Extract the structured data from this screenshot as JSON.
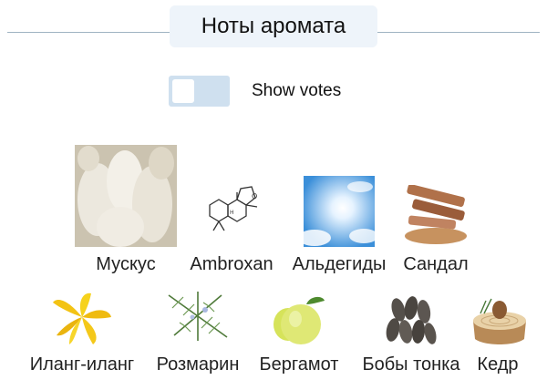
{
  "header": {
    "title": "Ноты аромата"
  },
  "votes_toggle": {
    "label": "Show votes",
    "checked": false
  },
  "notes_row1": [
    {
      "label": "Мускус",
      "icon": "musk-image"
    },
    {
      "label": "Ambroxan",
      "icon": "ambroxan-molecule-image"
    },
    {
      "label": "Альдегиды",
      "icon": "aldehydes-sky-image"
    },
    {
      "label": "Сандал",
      "icon": "sandalwood-image"
    }
  ],
  "notes_row2": [
    {
      "label": "Иланг-иланг",
      "icon": "ylang-ylang-flower-image"
    },
    {
      "label": "Розмарин",
      "icon": "rosemary-image"
    },
    {
      "label": "Бергамот",
      "icon": "bergamot-image"
    },
    {
      "label": "Бобы тонка",
      "icon": "tonka-beans-image"
    },
    {
      "label": "Кедр",
      "icon": "cedar-image"
    }
  ],
  "colors": {
    "accent_bg": "#eef4fa",
    "toggle_bg": "#cfe0ef",
    "rule": "#9fb3c2"
  }
}
